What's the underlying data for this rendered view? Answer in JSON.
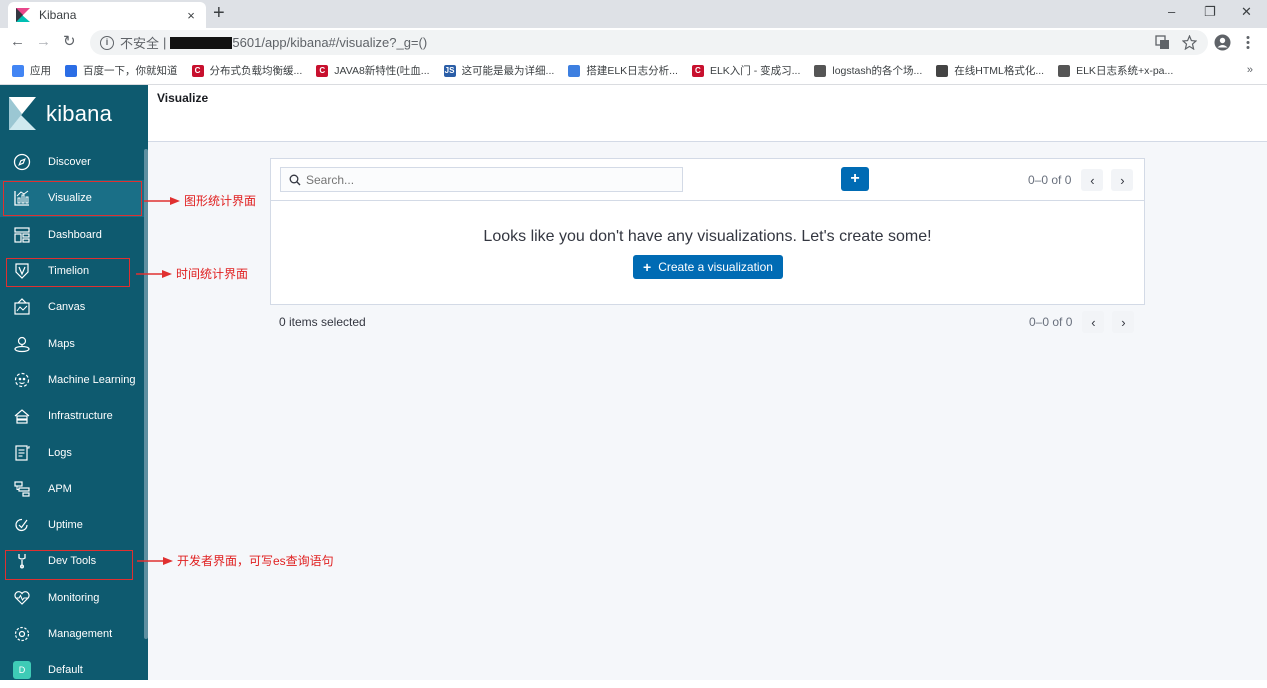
{
  "browser": {
    "tab_title": "Kibana",
    "tab_close": "×",
    "new_tab": "+",
    "window_controls": {
      "minimize": "–",
      "maximize": "❐",
      "close": "✕"
    },
    "nav": {
      "back": "←",
      "forward": "→",
      "reload": "↻"
    },
    "insecure_label": "不安全",
    "url_separator": "|",
    "url_visible": "5601/app/kibana#/visualize?_g=()",
    "bookmarks": [
      {
        "label": "应用",
        "color": "#4285f4",
        "glyph": ""
      },
      {
        "label": "百度一下，你就知道",
        "color": "#2b6de5",
        "glyph": ""
      },
      {
        "label": "分布式负载均衡缓...",
        "color": "#c8102e",
        "glyph": "C"
      },
      {
        "label": "JAVA8新特性(吐血...",
        "color": "#c8102e",
        "glyph": "C"
      },
      {
        "label": "这可能是最为详细...",
        "color": "#2b5ea7",
        "glyph": "JS"
      },
      {
        "label": "搭建ELK日志分析...",
        "color": "#3d7fe0",
        "glyph": ""
      },
      {
        "label": "ELK入门 - 变成习...",
        "color": "#c8102e",
        "glyph": "C"
      },
      {
        "label": "logstash的各个场...",
        "color": "#555555",
        "glyph": ""
      },
      {
        "label": "在线HTML格式化...",
        "color": "#444444",
        "glyph": ""
      },
      {
        "label": "ELK日志系统+x-pa...",
        "color": "#555555",
        "glyph": ""
      }
    ],
    "bookmarks_more": "»"
  },
  "kibana": {
    "logo_text": "kibana",
    "nav": [
      {
        "label": "Discover",
        "icon": "compass-icon"
      },
      {
        "label": "Visualize",
        "icon": "visualize-icon"
      },
      {
        "label": "Dashboard",
        "icon": "dashboard-icon"
      },
      {
        "label": "Timelion",
        "icon": "timelion-icon"
      },
      {
        "label": "Canvas",
        "icon": "canvas-icon"
      },
      {
        "label": "Maps",
        "icon": "maps-icon"
      },
      {
        "label": "Machine Learning",
        "icon": "ml-icon"
      },
      {
        "label": "Infrastructure",
        "icon": "infrastructure-icon"
      },
      {
        "label": "Logs",
        "icon": "logs-icon"
      },
      {
        "label": "APM",
        "icon": "apm-icon"
      },
      {
        "label": "Uptime",
        "icon": "uptime-icon"
      },
      {
        "label": "Dev Tools",
        "icon": "wrench-icon"
      },
      {
        "label": "Monitoring",
        "icon": "monitoring-icon"
      },
      {
        "label": "Management",
        "icon": "gear-icon"
      },
      {
        "label": "Default",
        "icon": "space-avatar",
        "badge": "D"
      }
    ],
    "active_item": "Visualize",
    "breadcrumb": "Visualize",
    "search_placeholder": "Search...",
    "add_button": "+",
    "pagination_top": "0–0 of 0",
    "empty_message": "Looks like you don't have any visualizations. Let's create some!",
    "create_button": "Create a visualization",
    "items_selected": "0 items selected",
    "pagination_bottom": "0–0 of 0",
    "prev_arrow": "‹",
    "next_arrow": "›"
  },
  "annotations": [
    {
      "target": "Visualize",
      "text": "图形统计界面"
    },
    {
      "target": "Timelion",
      "text": "时间统计界面"
    },
    {
      "target": "Dev Tools",
      "text": "开发者界面，可写es查询语句"
    }
  ],
  "colors": {
    "sidebar": "#0e5a6f",
    "active": "#1a6f87",
    "primary_button": "#006bb4",
    "annotation": "#e03030"
  }
}
